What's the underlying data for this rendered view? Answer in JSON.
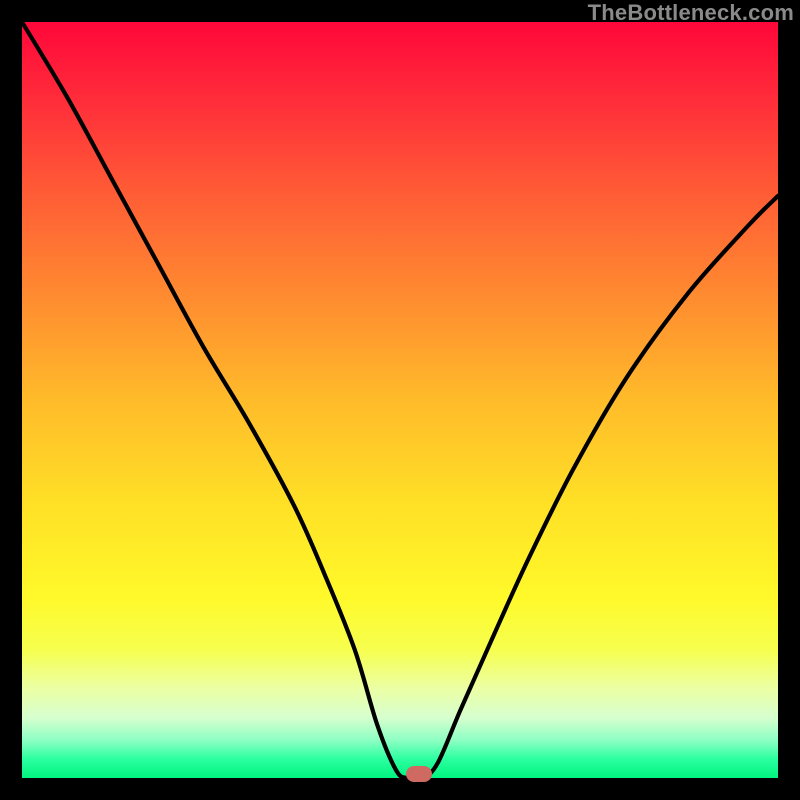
{
  "watermark": "TheBottleneck.com",
  "colors": {
    "frame": "#000000",
    "curve": "#000000",
    "marker": "#cf6a63",
    "gradient_top": "#ff073a",
    "gradient_bottom": "#00f47f"
  },
  "chart_data": {
    "type": "line",
    "title": "",
    "xlabel": "",
    "ylabel": "",
    "xlim": [
      0,
      100
    ],
    "ylim": [
      0,
      100
    ],
    "series": [
      {
        "name": "bottleneck-curve",
        "x": [
          0,
          6,
          12,
          18,
          24,
          30,
          36,
          40,
          44,
          47,
          49.5,
          51,
          53,
          55,
          58,
          62,
          67,
          73,
          80,
          88,
          96,
          100
        ],
        "values": [
          100,
          90,
          79,
          68,
          57,
          47,
          36,
          27,
          17,
          7,
          1,
          0,
          0,
          2,
          9,
          18,
          29,
          41,
          53,
          64,
          73,
          77
        ]
      }
    ],
    "annotations": [
      {
        "name": "optimal-marker",
        "x": 52.5,
        "y": 0.5
      }
    ]
  }
}
